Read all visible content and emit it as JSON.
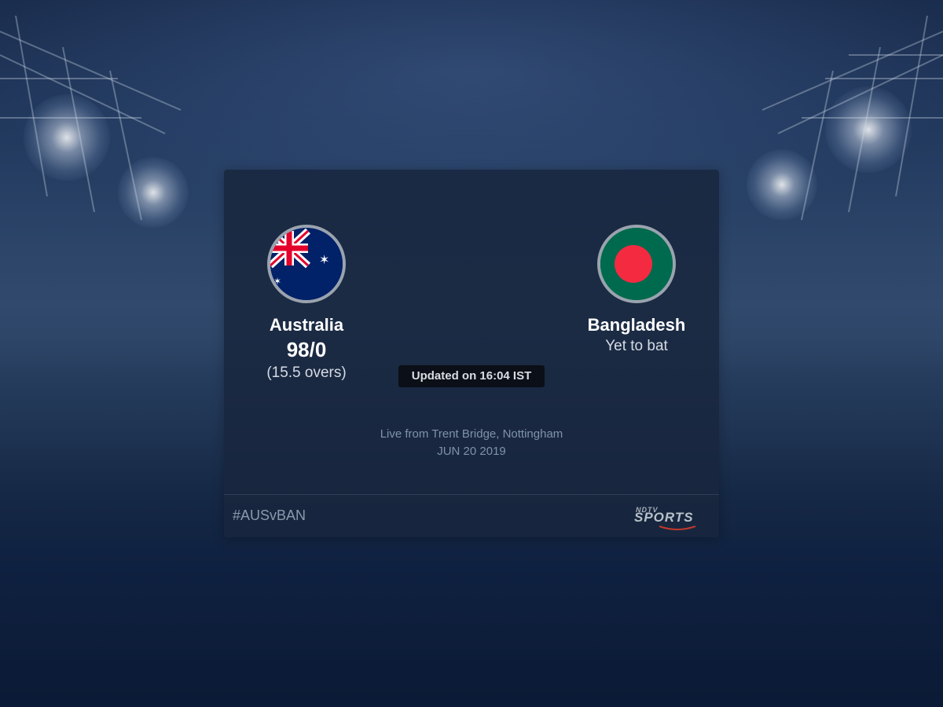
{
  "teams": {
    "home": {
      "name": "Australia",
      "score": "98/0",
      "overs": "(15.5 overs)",
      "flag_icon": "australia-flag-icon"
    },
    "away": {
      "name": "Bangladesh",
      "status": "Yet to bat",
      "flag_icon": "bangladesh-flag-icon"
    }
  },
  "update": {
    "label": "Updated on 16:04 IST"
  },
  "match": {
    "venue": "Live from Trent Bridge, Nottingham",
    "date": "JUN 20 2019"
  },
  "footer": {
    "hashtag": "#AUSvBAN",
    "brand_top": "NDTV",
    "brand_main": "SPORTS"
  },
  "colors": {
    "card_bg": "#18263e",
    "flag_ring": "#9aa3ae",
    "bangladesh_green": "#006a4e",
    "bangladesh_red": "#f42a41",
    "australia_blue": "#012169",
    "muted_text": "#7f92ab"
  }
}
